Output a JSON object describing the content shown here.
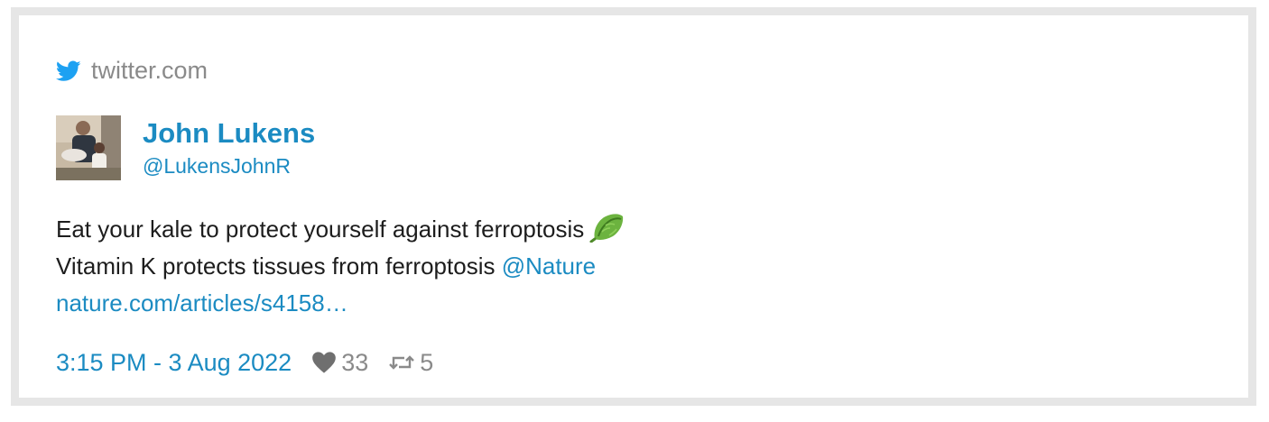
{
  "source": {
    "label": "twitter.com",
    "icon": "twitter-bird-icon"
  },
  "author": {
    "name": "John Lukens",
    "handle": "@LukensJohnR",
    "avatar_icon": "avatar-photo"
  },
  "tweet": {
    "line1": "Eat your kale to protect yourself against ferroptosis",
    "line1_emoji_icon": "leafy-green-icon",
    "line2_text": "Vitamin K protects tissues from ferroptosis ",
    "line2_mention": "@Nature",
    "line3_link": "nature.com/articles/s4158…"
  },
  "footer": {
    "timestamp": "3:15 PM - 3 Aug 2022",
    "likes": "33",
    "retweets": "5"
  },
  "colors": {
    "link": "#1b8bc2",
    "muted": "#8a8a8a",
    "frame": "#e6e6e6"
  }
}
